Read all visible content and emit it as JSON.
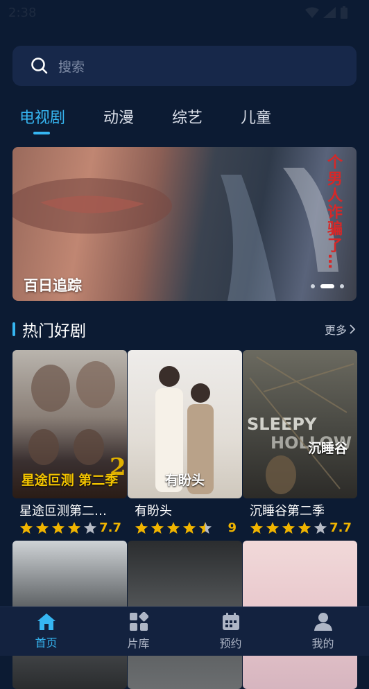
{
  "status": {
    "time": "2:38",
    "icons": [
      "wifi-icon",
      "signal-icon",
      "battery-icon"
    ]
  },
  "search": {
    "placeholder": "搜索"
  },
  "tabs": [
    {
      "label": "电视剧",
      "active": true
    },
    {
      "label": "动漫",
      "active": false
    },
    {
      "label": "综艺",
      "active": false
    },
    {
      "label": "儿童",
      "active": false
    }
  ],
  "banner": {
    "title": "百日追踪",
    "overlay_text": "个男人诈骗了…",
    "dot_count": 3,
    "active_dot": 1
  },
  "section": {
    "title": "热门好剧",
    "more": "更多"
  },
  "cards": [
    {
      "title": "星途叵测第二…",
      "rating_stars": 4,
      "score": "7.7",
      "caption": "星途叵测 第二季"
    },
    {
      "title": "有盼头",
      "rating_stars": 4.5,
      "score": "9",
      "caption": "有盼头"
    },
    {
      "title": "沉睡谷第二季",
      "rating_stars": 4,
      "score": "7.7",
      "caption": "沉睡谷"
    }
  ],
  "bottom_nav": [
    {
      "label": "首页",
      "icon": "home-icon",
      "active": true
    },
    {
      "label": "片库",
      "icon": "library-icon",
      "active": false
    },
    {
      "label": "预约",
      "icon": "calendar-icon",
      "active": false
    },
    {
      "label": "我的",
      "icon": "user-icon",
      "active": false
    }
  ],
  "colors": {
    "accent": "#36b6f2",
    "star": "#f0b400",
    "background": "#0c1b33"
  }
}
